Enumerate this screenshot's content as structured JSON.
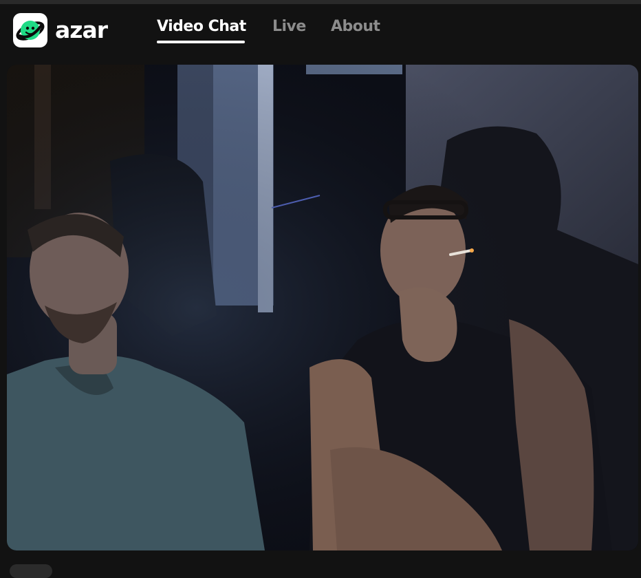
{
  "app": {
    "brand": "azar",
    "brand_color": "#1fdb86"
  },
  "nav": {
    "items": [
      {
        "label": "Video Chat",
        "active": true
      },
      {
        "label": "Live",
        "active": false
      },
      {
        "label": "About",
        "active": false
      }
    ]
  },
  "icons": {
    "logo": "azar-smile-planet-icon"
  }
}
